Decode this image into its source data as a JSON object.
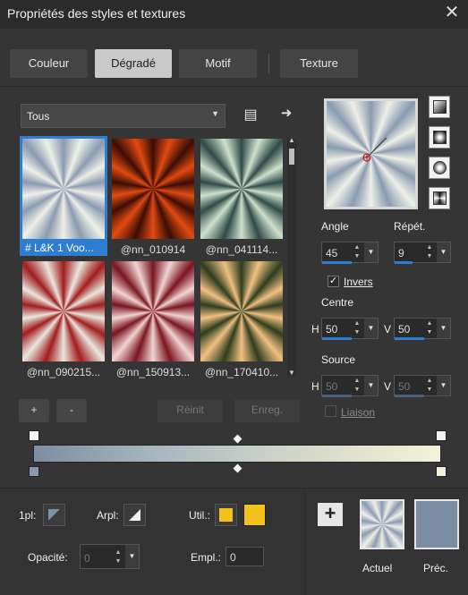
{
  "window": {
    "title": "Propriétés des styles et textures",
    "close": "✕"
  },
  "tabs": [
    {
      "label": "Couleur",
      "active": false
    },
    {
      "label": "Dégradé",
      "active": true
    },
    {
      "label": "Motif",
      "active": false
    },
    {
      "label": "Texture",
      "active": false
    }
  ],
  "filter": {
    "selected": "Tous",
    "caret": "▼"
  },
  "toolbar_icons": {
    "menu": "▤",
    "arrow": "➜"
  },
  "thumbnails": [
    {
      "caption": "# L&K 1 Voo...",
      "selected": true,
      "colors": [
        "#8a9bb0",
        "#eef0e8"
      ]
    },
    {
      "caption": "@nn_010914",
      "selected": false,
      "colors": [
        "#3b0d05",
        "#e14a12"
      ]
    },
    {
      "caption": "@nn_041114...",
      "selected": false,
      "colors": [
        "#2f4a48",
        "#cfe1cc"
      ]
    },
    {
      "caption": "@nn_090215...",
      "selected": false,
      "colors": [
        "#a11d1d",
        "#e9e6de"
      ]
    },
    {
      "caption": "@nn_150913...",
      "selected": false,
      "colors": [
        "#7a1520",
        "#f1d3d2"
      ]
    },
    {
      "caption": "@nn_170410...",
      "selected": false,
      "colors": [
        "#2e3d1f",
        "#f1c080"
      ]
    }
  ],
  "scroll": {
    "up": "▲",
    "down": "▼"
  },
  "buttons": {
    "add": "+",
    "remove": "-",
    "reset": "Réinit",
    "save": "Enreg."
  },
  "params": {
    "angle_label": "Angle",
    "angle_value": "45",
    "repeat_label": "Répét.",
    "repeat_value": "9",
    "invert_label": "Invers",
    "invert_checked": "✓",
    "centre_label": "Centre",
    "centre_h_label": "H",
    "centre_h": "50",
    "centre_v_label": "V",
    "centre_v": "50",
    "source_label": "Source",
    "source_h_label": "H",
    "source_h": "50",
    "source_v_label": "V",
    "source_v": "50",
    "link_label": "Liaison",
    "spin_up": "▲",
    "spin_down": "▼",
    "dd": "▼"
  },
  "footer": {
    "first_plan_label": "1pl:",
    "arrplan_label": "Arpl:",
    "util_label": "Util.:",
    "opacity_label": "Opacité:",
    "opacity_value": "0",
    "empl_label": "Empl.:",
    "empl_value": "0",
    "util_colors": [
      "#f2c21a",
      "#f2c21a"
    ],
    "plus": "+",
    "current_label": "Actuel",
    "previous_label": "Préc.",
    "previous_color": "#7a8da3"
  }
}
